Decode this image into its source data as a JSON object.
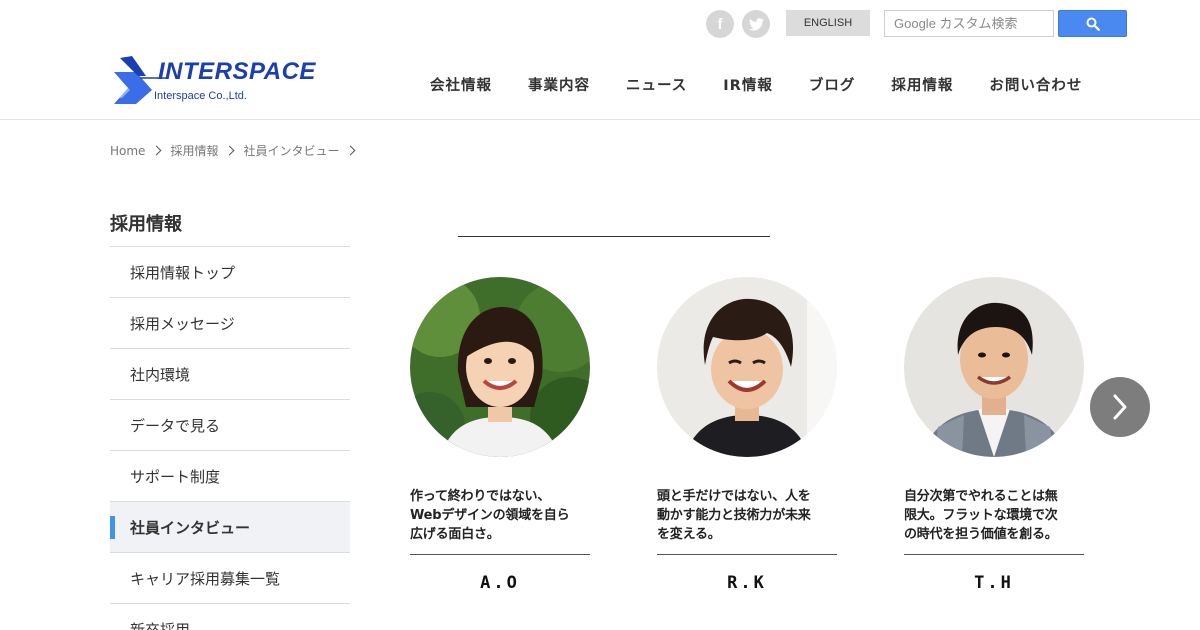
{
  "header": {
    "social": [
      {
        "name": "facebook",
        "glyph": "f"
      },
      {
        "name": "twitter",
        "glyph": "t"
      }
    ],
    "english_label": "ENGLISH",
    "search": {
      "placeholder": "Google カスタム検索",
      "button_icon": "search-icon"
    },
    "logo": {
      "main": "INTERSPACE",
      "sub": "Interspace Co.,Ltd."
    },
    "nav": [
      "会社情報",
      "事業内容",
      "ニュース",
      "IR情報",
      "ブログ",
      "採用情報",
      "お問い合わせ"
    ]
  },
  "breadcrumb": [
    "Home",
    "採用情報",
    "社員インタビュー"
  ],
  "sidebar": {
    "title": "採用情報",
    "items": [
      {
        "label": "採用情報トップ",
        "active": false
      },
      {
        "label": "採用メッセージ",
        "active": false
      },
      {
        "label": "社内環境",
        "active": false
      },
      {
        "label": "データで見る",
        "active": false
      },
      {
        "label": "サポート制度",
        "active": false
      },
      {
        "label": "社員インタビュー",
        "active": true
      },
      {
        "label": "キャリア採用募集一覧",
        "active": false
      },
      {
        "label": "新卒採用",
        "active": false
      }
    ]
  },
  "interviews": [
    {
      "catch_lines": [
        "作って終わりではない、",
        "Webデザインの領域を自ら",
        "広げる面白さ。"
      ],
      "initials": "A.O"
    },
    {
      "catch_lines": [
        "頭と手だけではない、人を",
        "動かす能力と技術力が未来",
        "を変える。"
      ],
      "initials": "R.K"
    },
    {
      "catch_lines": [
        "自分次第でやれることは無",
        "限大。フラットな環境で次",
        "の時代を担う価値を創る。"
      ],
      "initials": "T.H"
    }
  ],
  "colors": {
    "brand": "#1a3fb5",
    "accent": "#3d96e8",
    "search_button": "#4a89f0"
  }
}
